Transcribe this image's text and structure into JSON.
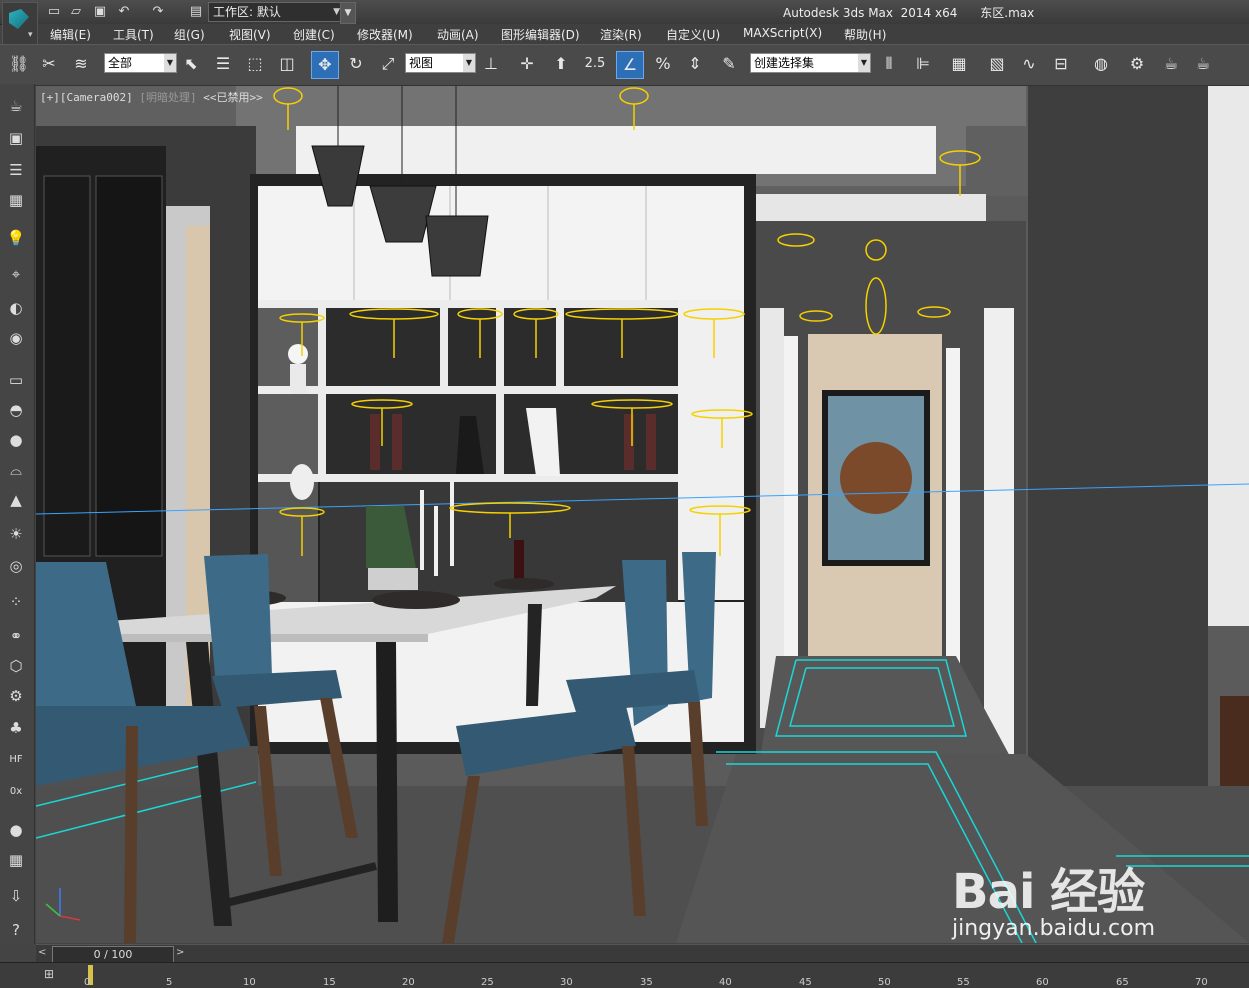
{
  "app": {
    "title": "Autodesk 3ds Max  2014 x64",
    "file": "东区.max",
    "workspace_label": "工作区: 默认"
  },
  "menu": [
    "编辑(E)",
    "工具(T)",
    "组(G)",
    "视图(V)",
    "创建(C)",
    "修改器(M)",
    "动画(A)",
    "图形编辑器(D)",
    "渲染(R)",
    "自定义(U)",
    "MAXScript(X)",
    "帮助(H)"
  ],
  "toolbar": {
    "selection_filter": "全部",
    "reference_coord": "视图",
    "snap_value": "2.5",
    "named_selection": "创建选择集"
  },
  "viewport": {
    "label_prefix": "[+][Camera002]",
    "label_shading": "[明暗处理]",
    "label_disabled": "<<已禁用>>"
  },
  "timeslider": {
    "value": "0 / 100"
  },
  "timeline": {
    "ticks": [
      "0",
      "5",
      "10",
      "15",
      "20",
      "25",
      "30",
      "35",
      "40",
      "45",
      "50",
      "55",
      "60",
      "65",
      "70"
    ]
  },
  "watermark": {
    "logo": "Bai 经验",
    "url": "jingyan.baidu.com"
  },
  "icons": {
    "logo": "3ds-max-logo-icon",
    "new": "new-file-icon",
    "open": "open-file-icon",
    "save": "save-icon",
    "undo": "undo-icon",
    "redo": "redo-icon"
  },
  "colors": {
    "light_gizmo": "#f5d100",
    "floor_outline": "#19d7d7",
    "chair": "#3d6a86",
    "active_tool": "#2d6fb7"
  }
}
